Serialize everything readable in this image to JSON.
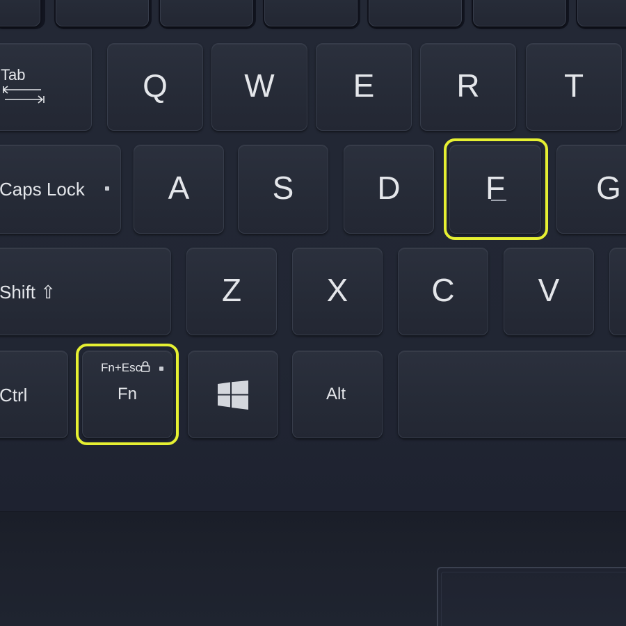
{
  "keyboard": {
    "row_q": {
      "q": "Q",
      "w": "W",
      "e": "E",
      "r": "R",
      "t": "T",
      "tab": "Tab"
    },
    "row_a": {
      "caps": "Caps Lock",
      "a": "A",
      "s": "S",
      "d": "D",
      "f": "F",
      "g": "G"
    },
    "row_z": {
      "shift": "Shift ⇧",
      "z": "Z",
      "x": "X",
      "c": "C",
      "v": "V"
    },
    "row_bottom": {
      "ctrl": "Ctrl",
      "fn_top": "Fn+Esc",
      "fn": "Fn",
      "alt": "Alt"
    }
  },
  "highlight_color": "#e6f032"
}
